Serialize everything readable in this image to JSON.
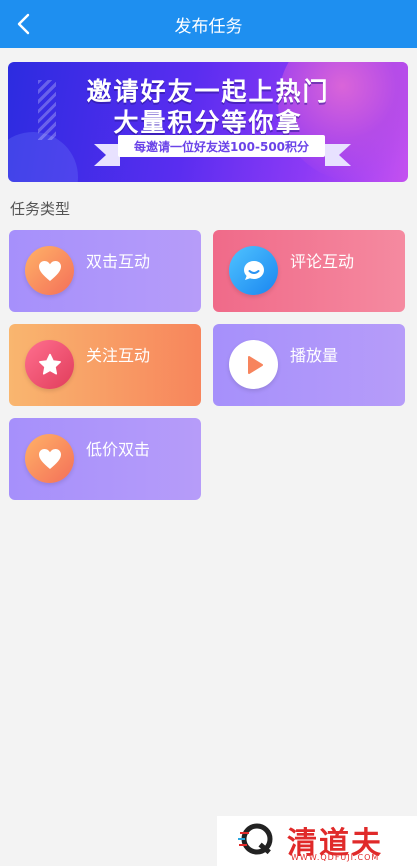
{
  "header": {
    "title": "发布任务",
    "back_icon": "chevron-left-icon"
  },
  "banner": {
    "line1": "邀请好友一起上热门",
    "line2": "大量积分等你拿",
    "ribbon": "每邀请一位好友送100-500积分"
  },
  "section": {
    "title": "任务类型"
  },
  "tasks": [
    {
      "label": "双击互动",
      "icon": "heart-icon",
      "color": "purple"
    },
    {
      "label": "评论互动",
      "icon": "chat-bubble-icon",
      "color": "pink"
    },
    {
      "label": "关注互动",
      "icon": "star-icon",
      "color": "orange"
    },
    {
      "label": "播放量",
      "icon": "play-icon",
      "color": "purple"
    },
    {
      "label": "低价双击",
      "icon": "heart-icon",
      "color": "purple"
    }
  ],
  "watermark": {
    "brand": "清道夫",
    "url": "WWW.QDFUJI.COM"
  }
}
